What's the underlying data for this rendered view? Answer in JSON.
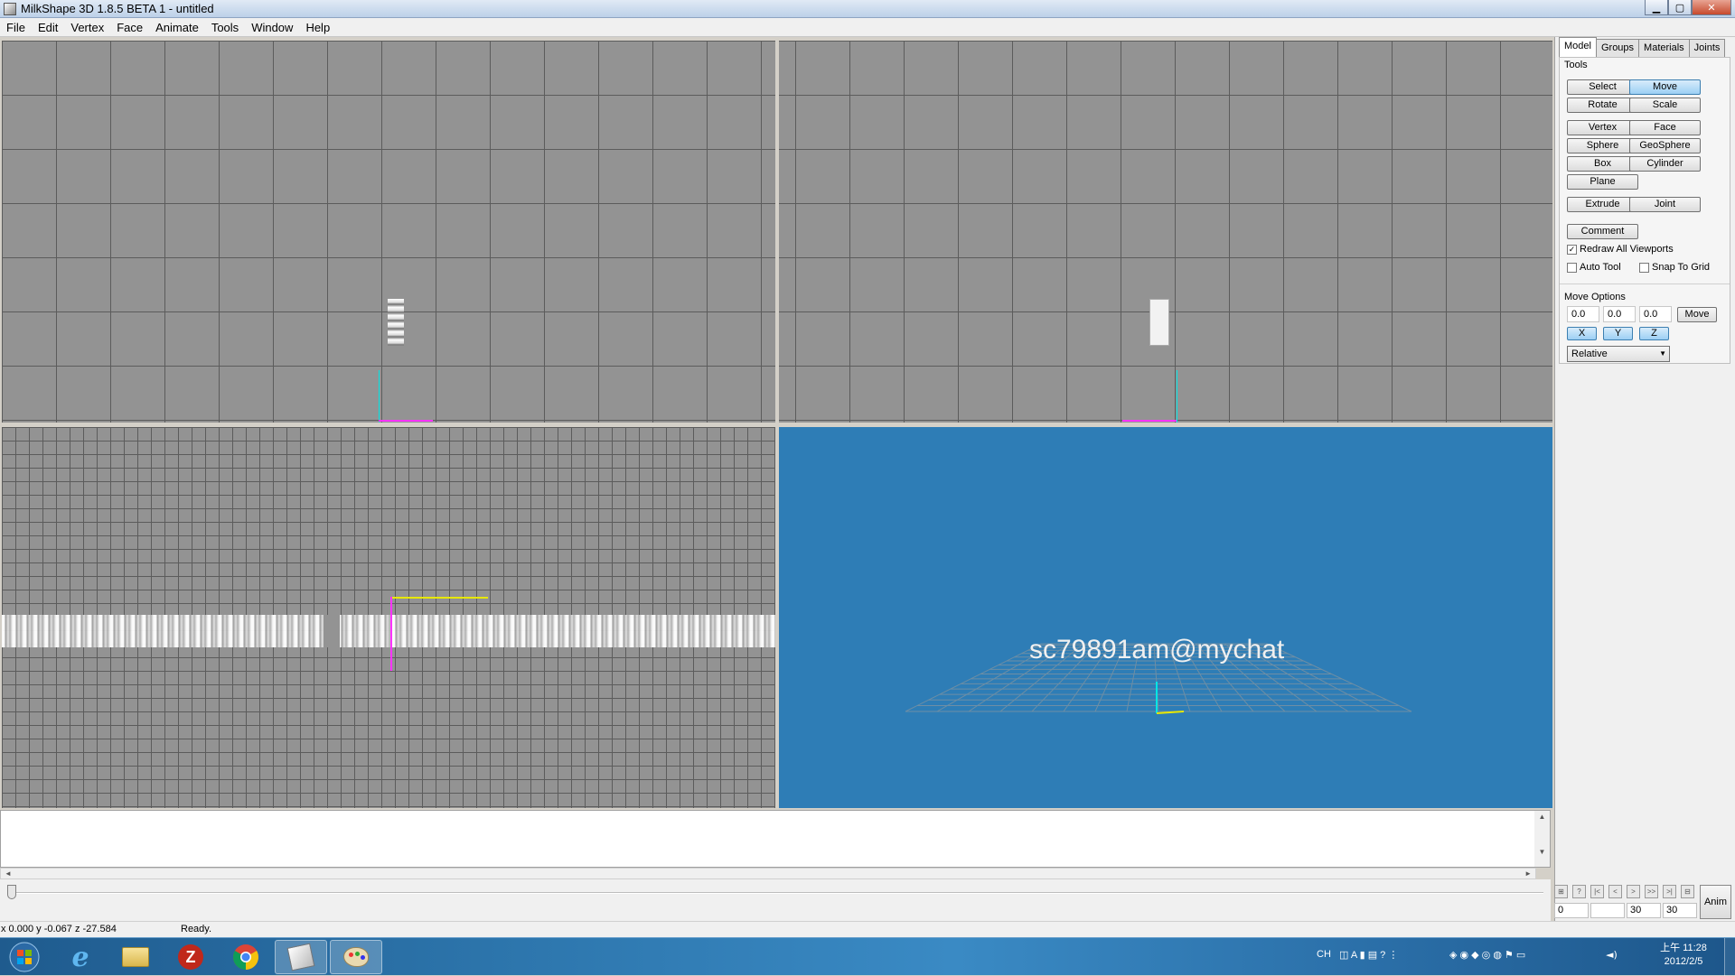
{
  "window": {
    "title": "MilkShape 3D 1.8.5 BETA 1 - untitled",
    "min": "▁",
    "max": "▢",
    "close": "✕"
  },
  "menu": [
    "File",
    "Edit",
    "Vertex",
    "Face",
    "Animate",
    "Tools",
    "Window",
    "Help"
  ],
  "viewport3d": {
    "overlay_text": "sc79891am@mychat"
  },
  "panel": {
    "tabs": [
      "Model",
      "Groups",
      "Materials",
      "Joints"
    ],
    "active_tab": "Model",
    "tools_label": "Tools",
    "buttons": {
      "select": "Select",
      "move": "Move",
      "rotate": "Rotate",
      "scale": "Scale",
      "vertex": "Vertex",
      "face": "Face",
      "sphere": "Sphere",
      "geosphere": "GeoSphere",
      "box": "Box",
      "cylinder": "Cylinder",
      "plane": "Plane",
      "extrude": "Extrude",
      "joint": "Joint",
      "comment": "Comment"
    },
    "active_tool": "Move",
    "redraw_all_viewports": {
      "label": "Redraw All Viewports",
      "checked": true,
      "mark": "✓"
    },
    "auto_tool": {
      "label": "Auto Tool",
      "checked": false
    },
    "snap_to_grid": {
      "label": "Snap To Grid",
      "checked": false
    },
    "move_options": {
      "label": "Move Options",
      "x": "0.0",
      "y": "0.0",
      "z": "0.0",
      "move_button": "Move",
      "axis_x": "X",
      "axis_y": "Y",
      "axis_z": "Z",
      "mode": "Relative"
    }
  },
  "timeline": {
    "buttons": [
      "⊞",
      "?",
      "|<",
      "<",
      ">",
      ">>",
      ">|",
      "⊟"
    ],
    "current_frame": "0",
    "blank": "",
    "start_frame": "30",
    "end_frame": "30",
    "anim_button": "Anim"
  },
  "status": {
    "coords": "x 0.000 y -0.067 z -27.584",
    "message": "Ready."
  },
  "scroll_glyphs": {
    "up": "▲",
    "down": "▼",
    "left": "◄",
    "right": "►"
  },
  "taskbar": {
    "apps": [
      "start-orb",
      "internet-explorer",
      "file-explorer",
      "filezilla",
      "chrome",
      "milkshape",
      "paint"
    ],
    "tray_lang": "CH",
    "clock_time": "上午 11:28",
    "clock_date": "2012/2/5"
  },
  "colors": {
    "viewport_bg": "#939393",
    "viewport3d_bg": "#2e7db6",
    "axis_cyan": "#00e5e5",
    "axis_magenta": "#ff33ff",
    "axis_yellow": "#e8e800"
  }
}
